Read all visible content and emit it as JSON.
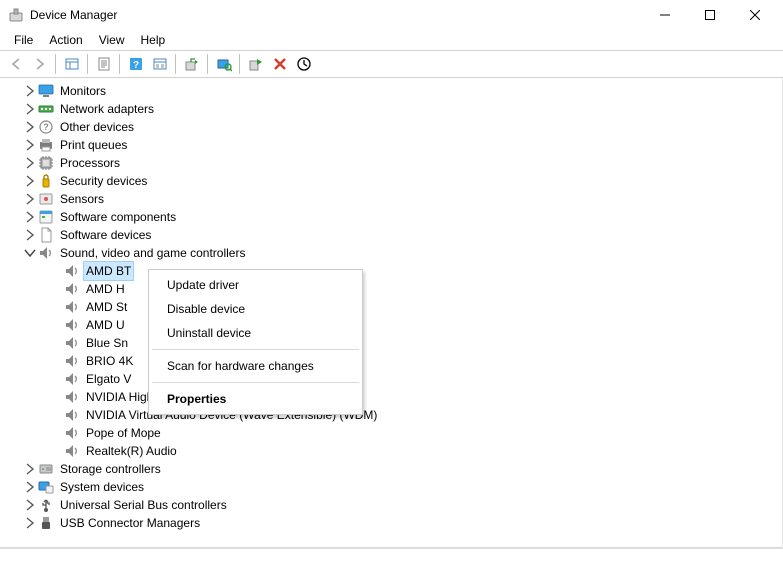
{
  "window": {
    "title": "Device Manager"
  },
  "menu": {
    "file": "File",
    "action": "Action",
    "view": "View",
    "help": "Help"
  },
  "tree": {
    "monitors": "Monitors",
    "network_adapters": "Network adapters",
    "other_devices": "Other devices",
    "print_queues": "Print queues",
    "processors": "Processors",
    "security_devices": "Security devices",
    "sensors": "Sensors",
    "software_components": "Software components",
    "software_devices": "Software devices",
    "sound_video_game": "Sound, video and game controllers",
    "sound_children": {
      "amd_bt": "AMD BT",
      "amd_h": "AMD H",
      "amd_st": "AMD St",
      "amd_u": "AMD U",
      "blue_sn": "Blue Sn",
      "brio_4k": "BRIO 4K",
      "elgato_v": "Elgato V",
      "nvidia_hd": "NVIDIA High Definition Audio",
      "nvidia_virtual": "NVIDIA Virtual Audio Device (Wave Extensible) (WDM)",
      "pope_of_mope": "Pope of Mope",
      "realtek": "Realtek(R) Audio"
    },
    "storage_controllers": "Storage controllers",
    "system_devices": "System devices",
    "usb_controllers": "Universal Serial Bus controllers",
    "usb_connector_managers": "USB Connector Managers"
  },
  "context_menu": {
    "update_driver": "Update driver",
    "disable_device": "Disable device",
    "uninstall_device": "Uninstall device",
    "scan_hardware": "Scan for hardware changes",
    "properties": "Properties"
  }
}
